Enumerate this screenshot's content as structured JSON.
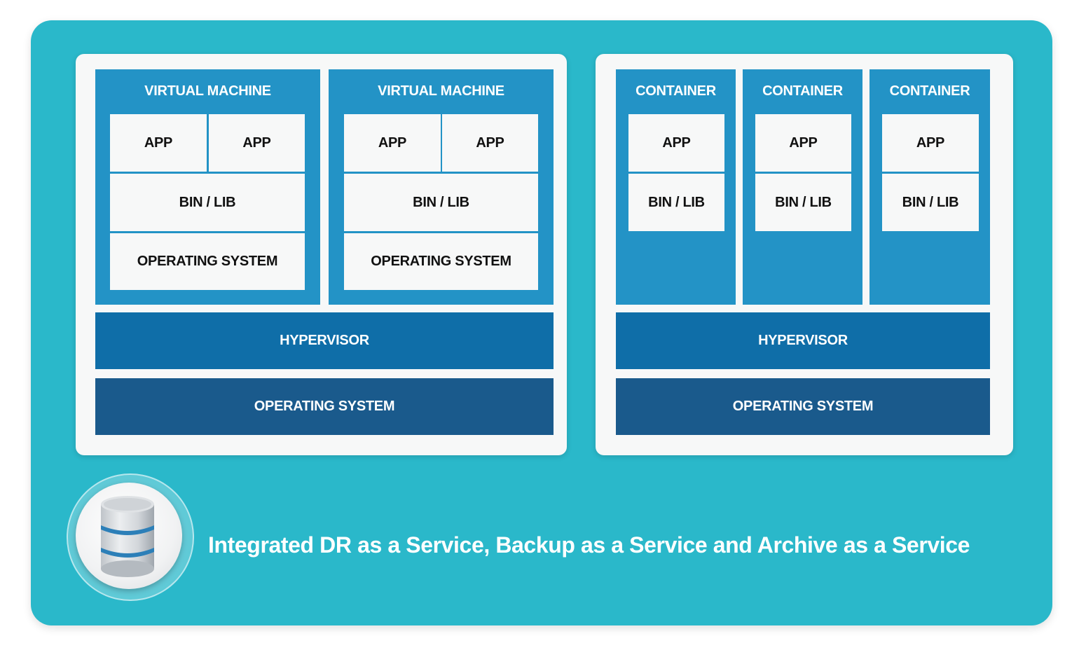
{
  "vm_panel": {
    "columns": [
      {
        "title": "VIRTUAL MACHINE",
        "app1": "APP",
        "app2": "APP",
        "binlib": "BIN / LIB",
        "os": "OPERATING SYSTEM"
      },
      {
        "title": "VIRTUAL MACHINE",
        "app1": "APP",
        "app2": "APP",
        "binlib": "BIN / LIB",
        "os": "OPERATING SYSTEM"
      }
    ],
    "hypervisor": "HYPERVISOR",
    "host_os": "OPERATING SYSTEM"
  },
  "container_panel": {
    "columns": [
      {
        "title": "CONTAINER",
        "app": "APP",
        "binlib": "BIN / LIB"
      },
      {
        "title": "CONTAINER",
        "app": "APP",
        "binlib": "BIN / LIB"
      },
      {
        "title": "CONTAINER",
        "app": "APP",
        "binlib": "BIN / LIB"
      }
    ],
    "hypervisor": "HYPERVISOR",
    "host_os": "OPERATING SYSTEM"
  },
  "footer": {
    "icon": "database-icon",
    "text": "Integrated DR as a Service, Backup as a Service and Archive as a Service"
  },
  "colors": {
    "background": "#2ab8ca",
    "panel": "#f7f8f8",
    "column": "#2393c6",
    "hypervisor": "#0f6ea8",
    "host_os": "#1a5a8c"
  }
}
